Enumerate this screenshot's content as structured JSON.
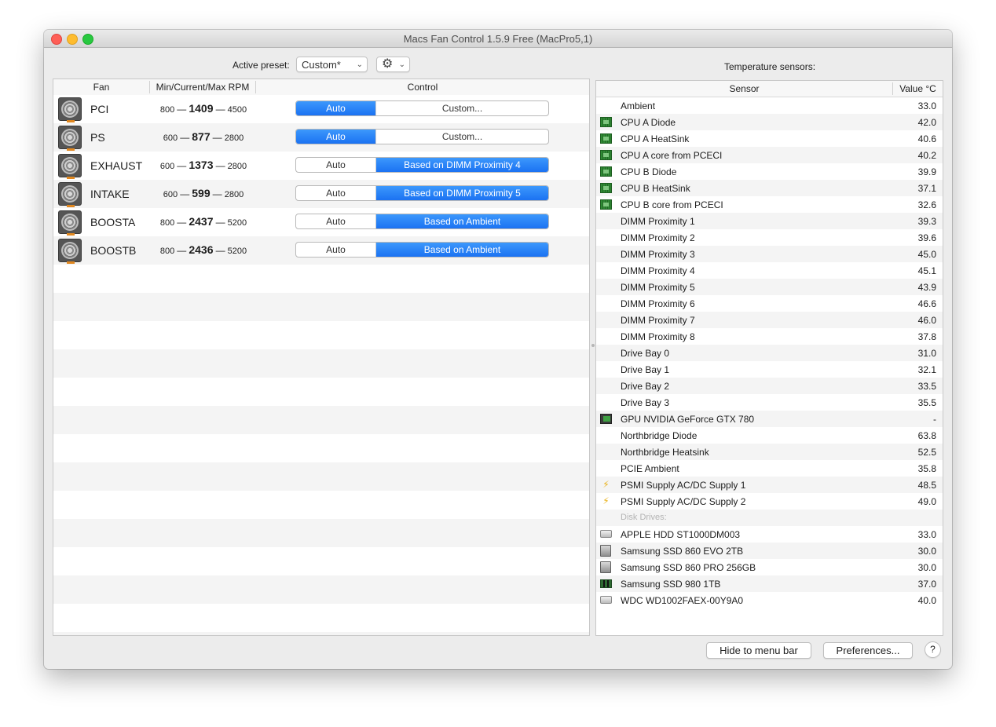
{
  "window": {
    "title": "Macs Fan Control 1.5.9 Free (MacPro5,1)"
  },
  "toolbar": {
    "preset_label": "Active preset:",
    "preset_value": "Custom*",
    "chevron": "⌄",
    "gear_icon": "⚙",
    "sensors_title": "Temperature sensors:"
  },
  "fans_table": {
    "headers": {
      "fan": "Fan",
      "rpm": "Min/Current/Max RPM",
      "control": "Control"
    },
    "dash": "—",
    "rows": [
      {
        "name": "PCI",
        "min": "800",
        "current": "1409",
        "max": "4500",
        "auto_label": "Auto",
        "custom_label": "Custom...",
        "mode": "auto"
      },
      {
        "name": "PS",
        "min": "600",
        "current": "877",
        "max": "2800",
        "auto_label": "Auto",
        "custom_label": "Custom...",
        "mode": "auto"
      },
      {
        "name": "EXHAUST",
        "min": "600",
        "current": "1373",
        "max": "2800",
        "auto_label": "Auto",
        "custom_label": "Based on DIMM Proximity 4",
        "mode": "custom"
      },
      {
        "name": "INTAKE",
        "min": "600",
        "current": "599",
        "max": "2800",
        "auto_label": "Auto",
        "custom_label": "Based on DIMM Proximity 5",
        "mode": "custom"
      },
      {
        "name": "BOOSTA",
        "min": "800",
        "current": "2437",
        "max": "5200",
        "auto_label": "Auto",
        "custom_label": "Based on Ambient",
        "mode": "custom"
      },
      {
        "name": "BOOSTB",
        "min": "800",
        "current": "2436",
        "max": "5200",
        "auto_label": "Auto",
        "custom_label": "Based on Ambient",
        "mode": "custom"
      }
    ]
  },
  "sensors_table": {
    "headers": {
      "sensor": "Sensor",
      "value": "Value °C"
    },
    "rows": [
      {
        "name": "Ambient",
        "value": "33.0",
        "icon": "none"
      },
      {
        "name": "CPU A Diode",
        "value": "42.0",
        "icon": "chip"
      },
      {
        "name": "CPU A HeatSink",
        "value": "40.6",
        "icon": "chip"
      },
      {
        "name": "CPU A core from PCECI",
        "value": "40.2",
        "icon": "chip"
      },
      {
        "name": "CPU B Diode",
        "value": "39.9",
        "icon": "chip"
      },
      {
        "name": "CPU B HeatSink",
        "value": "37.1",
        "icon": "chip"
      },
      {
        "name": "CPU B core from PCECI",
        "value": "32.6",
        "icon": "chip"
      },
      {
        "name": "DIMM Proximity 1",
        "value": "39.3",
        "icon": "none"
      },
      {
        "name": "DIMM Proximity 2",
        "value": "39.6",
        "icon": "none"
      },
      {
        "name": "DIMM Proximity 3",
        "value": "45.0",
        "icon": "none"
      },
      {
        "name": "DIMM Proximity 4",
        "value": "45.1",
        "icon": "none"
      },
      {
        "name": "DIMM Proximity 5",
        "value": "43.9",
        "icon": "none"
      },
      {
        "name": "DIMM Proximity 6",
        "value": "46.6",
        "icon": "none"
      },
      {
        "name": "DIMM Proximity 7",
        "value": "46.0",
        "icon": "none"
      },
      {
        "name": "DIMM Proximity 8",
        "value": "37.8",
        "icon": "none"
      },
      {
        "name": "Drive Bay 0",
        "value": "31.0",
        "icon": "none"
      },
      {
        "name": "Drive Bay 1",
        "value": "32.1",
        "icon": "none"
      },
      {
        "name": "Drive Bay 2",
        "value": "33.5",
        "icon": "none"
      },
      {
        "name": "Drive Bay 3",
        "value": "35.5",
        "icon": "none"
      },
      {
        "name": "GPU NVIDIA GeForce GTX 780",
        "value": "-",
        "icon": "gpu"
      },
      {
        "name": "Northbridge Diode",
        "value": "63.8",
        "icon": "none"
      },
      {
        "name": "Northbridge Heatsink",
        "value": "52.5",
        "icon": "none"
      },
      {
        "name": "PCIE Ambient",
        "value": "35.8",
        "icon": "none"
      },
      {
        "name": "PSMI Supply AC/DC Supply 1",
        "value": "48.5",
        "icon": "bolt"
      },
      {
        "name": "PSMI Supply AC/DC Supply 2",
        "value": "49.0",
        "icon": "bolt"
      },
      {
        "name": "Disk Drives:",
        "value": "",
        "icon": "none",
        "group": true
      },
      {
        "name": "APPLE HDD ST1000DM003",
        "value": "33.0",
        "icon": "hdd"
      },
      {
        "name": "Samsung SSD 860 EVO 2TB",
        "value": "30.0",
        "icon": "ssd"
      },
      {
        "name": "Samsung SSD 860 PRO 256GB",
        "value": "30.0",
        "icon": "ssd"
      },
      {
        "name": "Samsung SSD 980 1TB",
        "value": "37.0",
        "icon": "nvme"
      },
      {
        "name": "WDC WD1002FAEX-00Y9A0",
        "value": "40.0",
        "icon": "hdd"
      }
    ]
  },
  "footer": {
    "hide_label": "Hide to menu bar",
    "prefs_label": "Preferences...",
    "help_label": "?"
  },
  "colors": {
    "accent": "#1b72f2",
    "close": "#fe5f57",
    "minimize": "#febc2e",
    "maximize": "#28c840"
  }
}
